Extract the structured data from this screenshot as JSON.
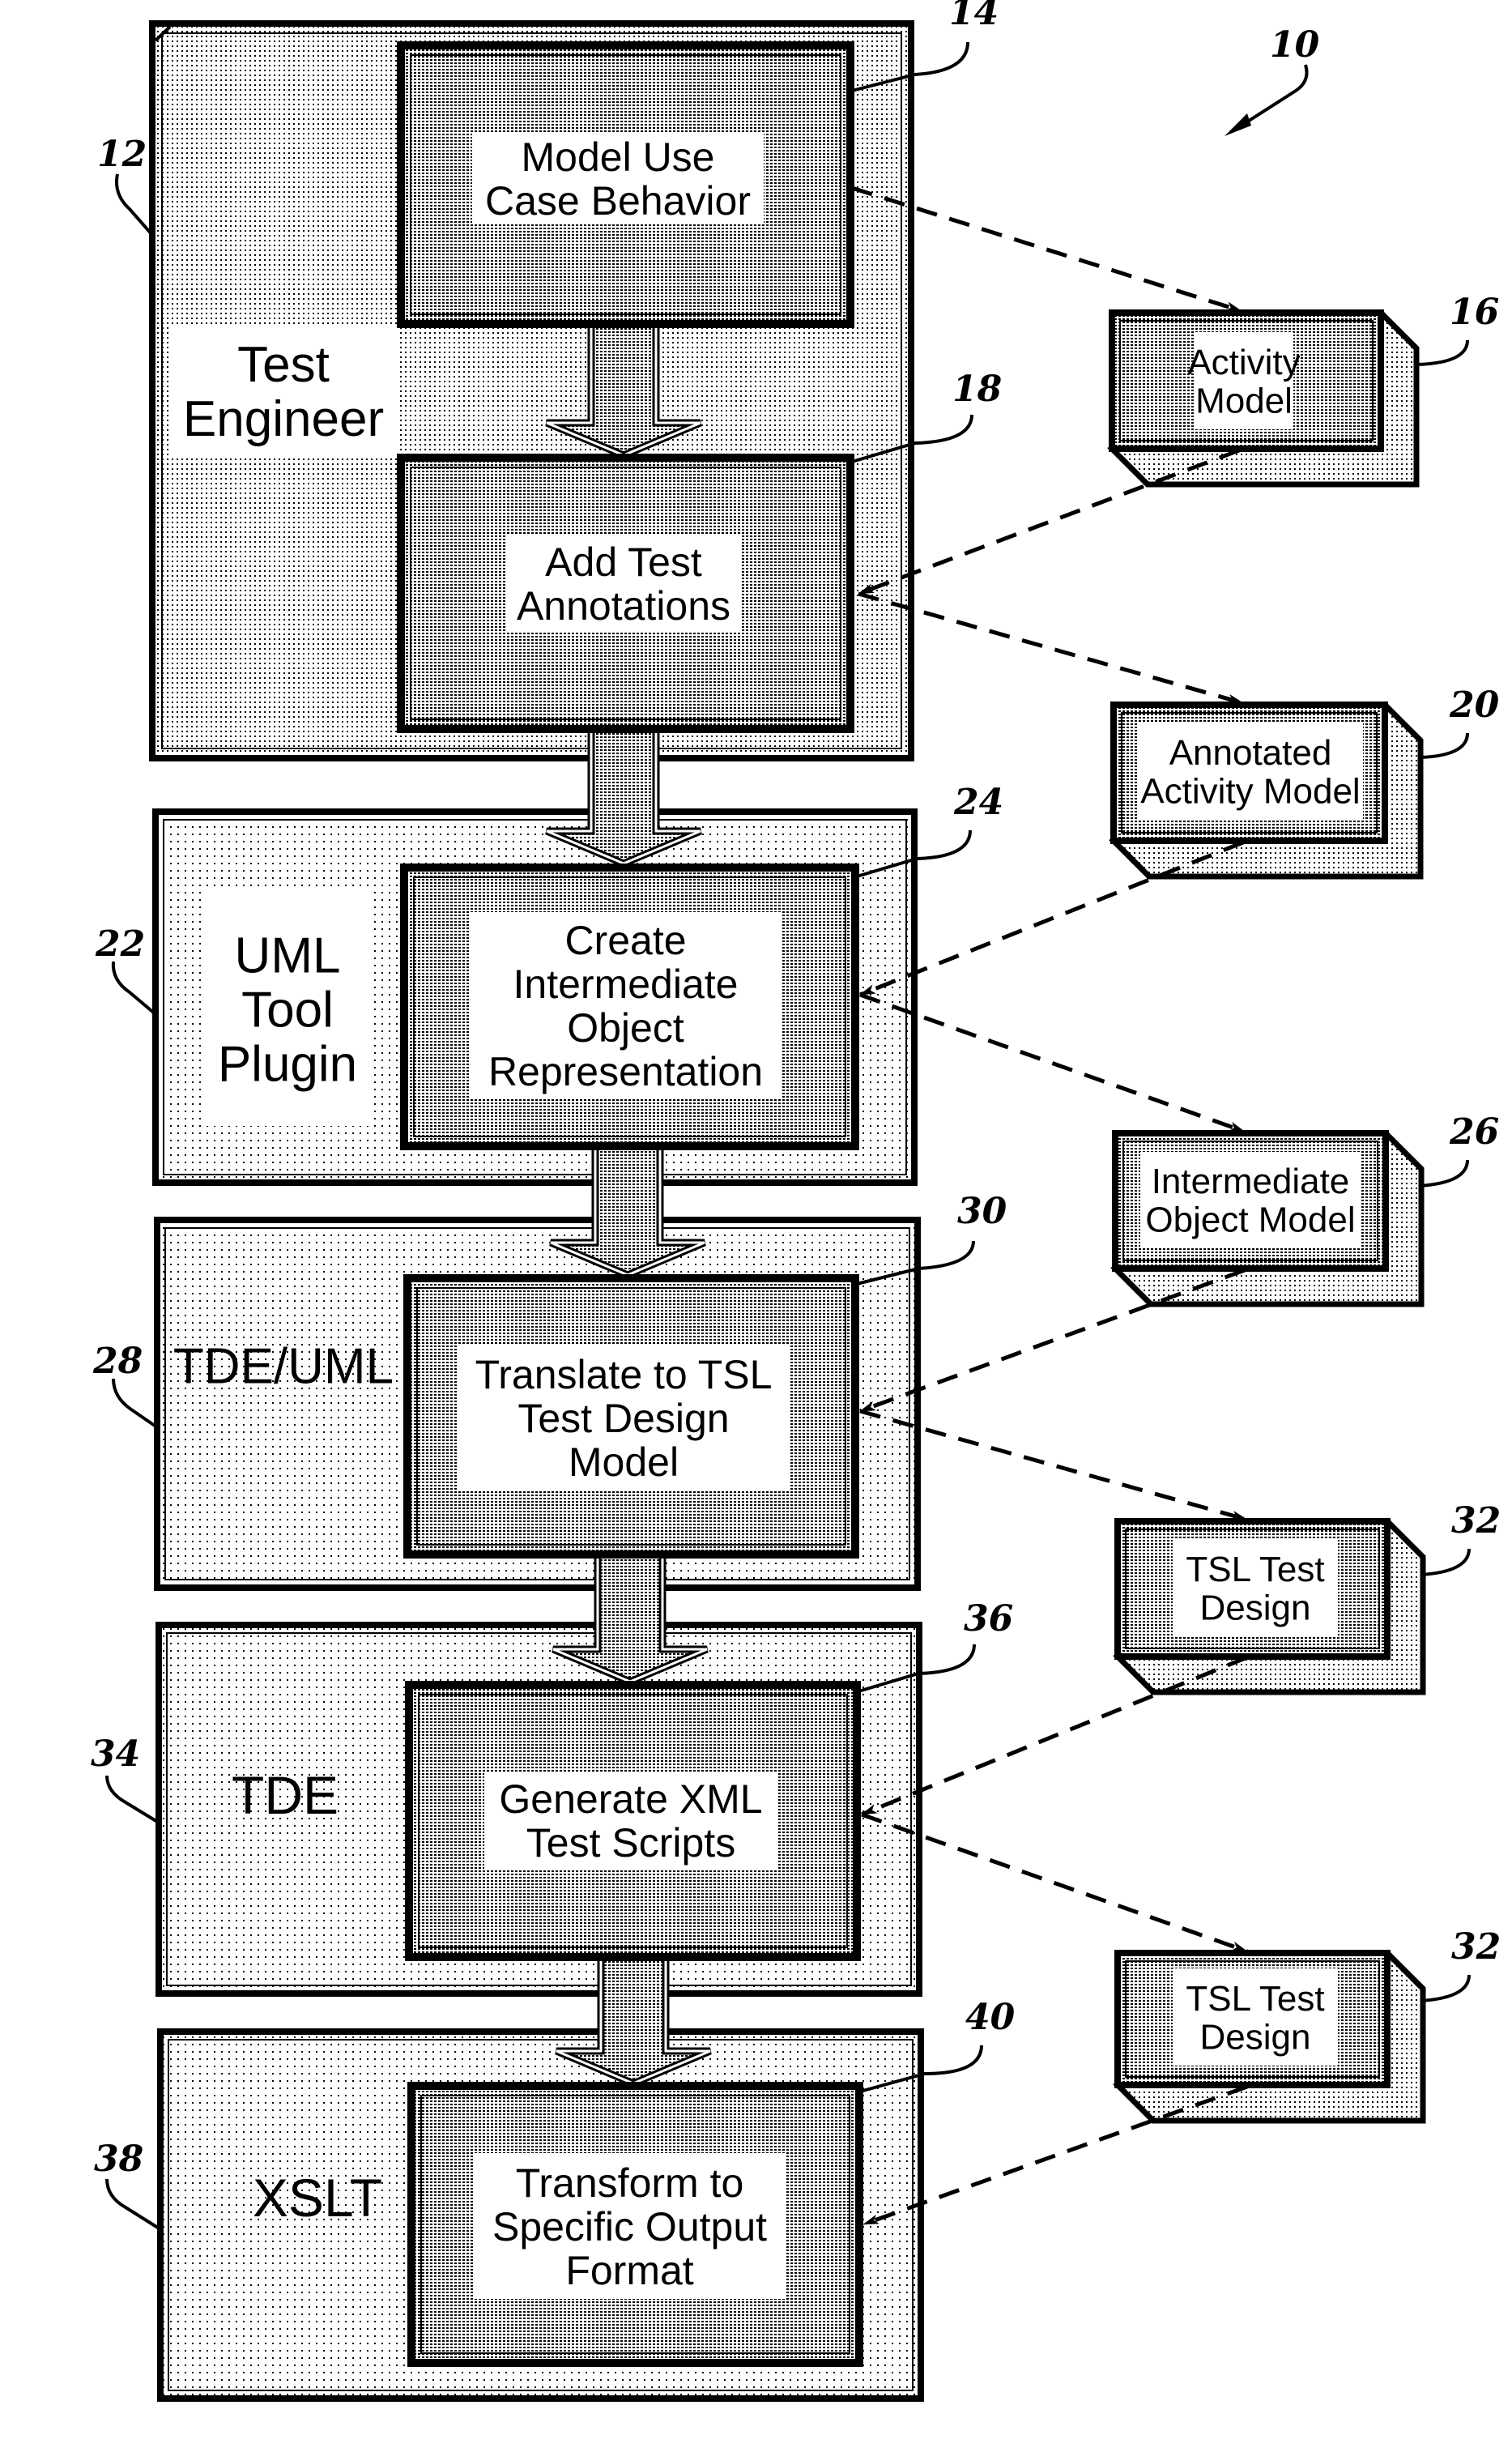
{
  "figure_number": "10",
  "colors": {
    "ink": "#000000",
    "paper": "#ffffff",
    "dot_light": "#000000"
  },
  "lanes": [
    {
      "id": "12",
      "label_lines": [
        "Test",
        "Engineer"
      ]
    },
    {
      "id": "22",
      "label_lines": [
        "UML",
        "Tool",
        "Plugin"
      ]
    },
    {
      "id": "28",
      "label_lines": [
        "TDE/UML"
      ]
    },
    {
      "id": "34",
      "label_lines": [
        "TDE"
      ]
    },
    {
      "id": "38",
      "label_lines": [
        "XSLT"
      ]
    }
  ],
  "steps": [
    {
      "id": "14",
      "label_lines": [
        "Model Use",
        "Case Behavior"
      ]
    },
    {
      "id": "18",
      "label_lines": [
        "Add Test",
        "Annotations"
      ]
    },
    {
      "id": "24",
      "label_lines": [
        "Create",
        "Intermediate",
        "Object",
        "Representation"
      ]
    },
    {
      "id": "30",
      "label_lines": [
        "Translate to TSL",
        "Test Design",
        "Model"
      ]
    },
    {
      "id": "36",
      "label_lines": [
        "Generate XML",
        "Test Scripts"
      ]
    },
    {
      "id": "40",
      "label_lines": [
        "Transform to",
        "Specific Output",
        "Format"
      ]
    }
  ],
  "artifacts": [
    {
      "id": "16",
      "label_lines": [
        "Activity",
        "Model"
      ]
    },
    {
      "id": "20",
      "label_lines": [
        "Annotated",
        "Activity Model"
      ]
    },
    {
      "id": "26",
      "label_lines": [
        "Intermediate",
        "Object Model"
      ]
    },
    {
      "id": "32",
      "label_lines": [
        "TSL Test",
        "Design"
      ]
    },
    {
      "id": "32",
      "label_lines": [
        "TSL Test",
        "Design"
      ]
    }
  ]
}
